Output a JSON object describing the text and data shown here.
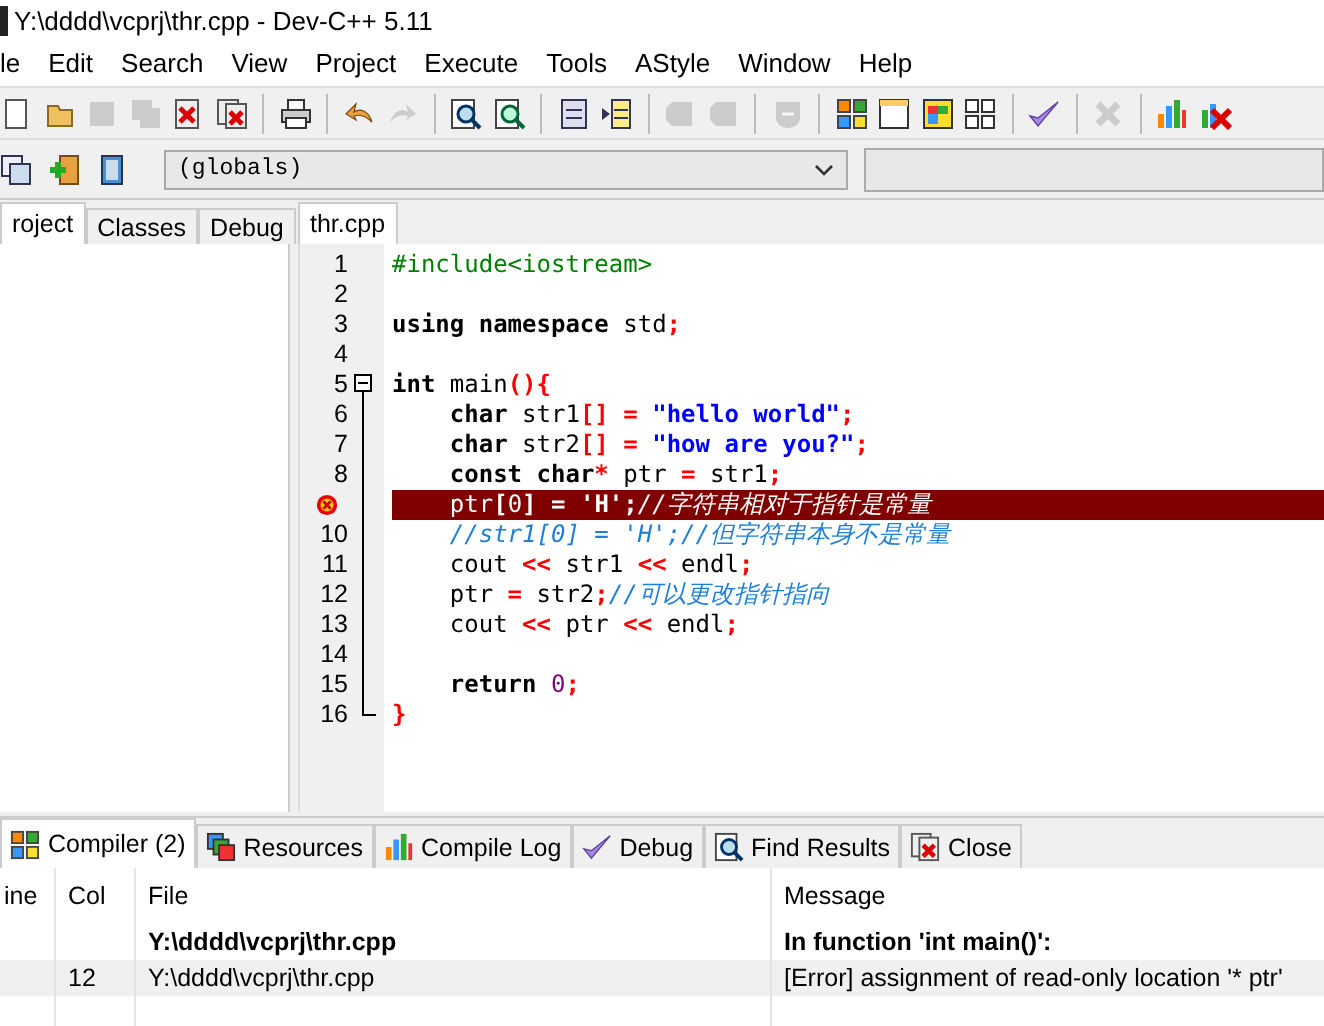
{
  "window": {
    "title": "Y:\\dddd\\vcprj\\thr.cpp - Dev-C++ 5.11"
  },
  "menu": [
    "le",
    "Edit",
    "Search",
    "View",
    "Project",
    "Execute",
    "Tools",
    "AStyle",
    "Window",
    "Help"
  ],
  "toolbar": [
    {
      "kind": "new",
      "disabled": false
    },
    {
      "kind": "open",
      "disabled": false
    },
    {
      "kind": "save",
      "disabled": true
    },
    {
      "kind": "saveall",
      "disabled": true
    },
    {
      "kind": "close",
      "disabled": false
    },
    {
      "kind": "closeall",
      "disabled": false
    },
    {
      "kind": "sep"
    },
    {
      "kind": "print",
      "disabled": false
    },
    {
      "kind": "sep"
    },
    {
      "kind": "undo",
      "disabled": false
    },
    {
      "kind": "redo",
      "disabled": true
    },
    {
      "kind": "sep"
    },
    {
      "kind": "find",
      "disabled": false
    },
    {
      "kind": "replace",
      "disabled": false
    },
    {
      "kind": "sep"
    },
    {
      "kind": "indent",
      "disabled": false
    },
    {
      "kind": "unindent",
      "disabled": false
    },
    {
      "kind": "sep"
    },
    {
      "kind": "bookmark",
      "disabled": true
    },
    {
      "kind": "bookmark",
      "disabled": true
    },
    {
      "kind": "sep"
    },
    {
      "kind": "shield",
      "disabled": true
    },
    {
      "kind": "sep"
    },
    {
      "kind": "colorgrid",
      "disabled": false
    },
    {
      "kind": "window",
      "disabled": false
    },
    {
      "kind": "colorwindow",
      "disabled": false
    },
    {
      "kind": "grid",
      "disabled": false
    },
    {
      "kind": "sep"
    },
    {
      "kind": "check",
      "disabled": false
    },
    {
      "kind": "sep"
    },
    {
      "kind": "cross",
      "disabled": true
    },
    {
      "kind": "sep"
    },
    {
      "kind": "chart",
      "disabled": false
    },
    {
      "kind": "chartx",
      "disabled": false
    }
  ],
  "toolbar2": [
    {
      "kind": "stack",
      "disabled": false
    },
    {
      "kind": "add",
      "disabled": false
    },
    {
      "kind": "book",
      "disabled": false
    }
  ],
  "scope_combo": {
    "value": "(globals)"
  },
  "left_tabs": [
    {
      "label": "roject",
      "selected": true
    },
    {
      "label": "Classes",
      "selected": false
    },
    {
      "label": "Debug",
      "selected": false
    }
  ],
  "editor_tabs": [
    {
      "label": "thr.cpp",
      "selected": true
    }
  ],
  "code_lines": [
    {
      "number": "1",
      "error": false,
      "kind": "plain",
      "text": "#include<iostream>"
    },
    {
      "number": "2",
      "error": false,
      "kind": "plain"
    },
    {
      "number": "3",
      "error": false,
      "kind": "plain",
      "text": "**using** **namespace** std;"
    },
    {
      "number": "4",
      "error": false,
      "kind": "plain"
    },
    {
      "number": "5",
      "error": false,
      "kind": "fold_start",
      "text": "**int** main(){"
    },
    {
      "number": "6",
      "error": false,
      "kind": "fold_body",
      "text": "    **char** str1[] = \"hello world\";"
    },
    {
      "number": "7",
      "error": false,
      "kind": "fold_body",
      "text": "    **char** str2[] = \"how are you?\";"
    },
    {
      "number": "8",
      "error": false,
      "kind": "fold_body",
      "text": "    **const** **char*** ptr = str1;"
    },
    {
      "error": true,
      "kind": "fold_body",
      "text": "    ptr[0] = 'H';//字符串相对于指针是常量"
    },
    {
      "number": "10",
      "error": false,
      "kind": "fold_body",
      "text": "    //str1[0] = 'H';//但字符串本身不是常量"
    },
    {
      "number": "11",
      "error": false,
      "kind": "fold_body",
      "text": "    cout << str1 << endl;"
    },
    {
      "number": "12",
      "error": false,
      "kind": "fold_body",
      "text": "    ptr = str2;//可以更改指针指向"
    },
    {
      "number": "13",
      "error": false,
      "kind": "fold_body",
      "text": "    cout << ptr << endl;"
    },
    {
      "number": "14",
      "error": false,
      "kind": "fold_body"
    },
    {
      "number": "15",
      "error": false,
      "kind": "fold_body",
      "text": "    **return** 0;"
    },
    {
      "number": "16",
      "error": false,
      "kind": "fold_end",
      "text": "}"
    }
  ],
  "bottom_tabs": [
    {
      "label": "Compiler (2)",
      "selected": true
    },
    {
      "label": "Resources",
      "selected": false
    },
    {
      "label": "Compile Log",
      "selected": false
    },
    {
      "label": "Debug",
      "selected": false
    },
    {
      "label": "Find Results",
      "selected": false
    },
    {
      "label": "Close",
      "selected": false
    }
  ],
  "table": {
    "columns": [
      "ine",
      "Col",
      "File",
      "Message"
    ],
    "rows": [
      {
        "kind": "header",
        "selected": false,
        "cells": [
          null,
          null,
          "Y:\\dddd\\vcprj\\thr.cpp",
          "In function 'int main()':"
        ]
      },
      {
        "kind": "error",
        "selected": true,
        "cells": [
          null,
          "12",
          "Y:\\dddd\\vcprj\\thr.cpp",
          "[Error] assignment of read-only location '* ptr'"
        ]
      }
    ]
  }
}
